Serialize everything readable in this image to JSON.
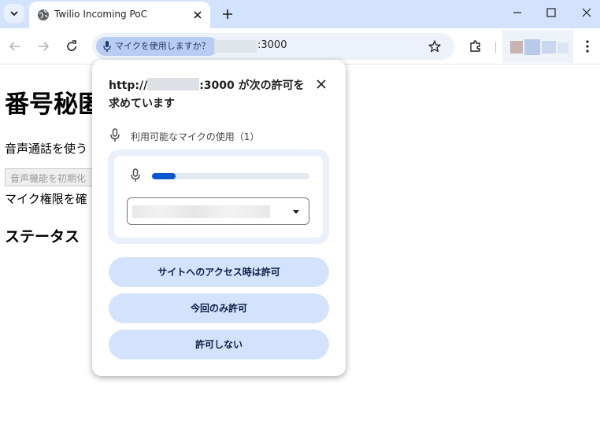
{
  "browser": {
    "tab": {
      "title": "Twilio Incoming PoC",
      "favicon": "globe-icon"
    },
    "omnibox": {
      "permission_chip": "マイクを使用しますか？",
      "url_suffix": ":3000"
    }
  },
  "page": {
    "heading": "番号秘匿",
    "description": "音声通話を使う",
    "init_button": "音声機能を初期化",
    "mic_permission_text": "マイク権限を確",
    "status_heading": "ステータス"
  },
  "permission_prompt": {
    "title_prefix": "http://",
    "title_suffix": ":3000 が次の許可を求めています",
    "permission_item": "利用可能なマイクの使用（1）",
    "mic_level": 0.15,
    "buttons": {
      "allow_on_visit": "サイトへのアクセス時は許可",
      "allow_this_time": "今回のみ許可",
      "deny": "許可しない"
    }
  },
  "colors": {
    "accent": "#0b57d0",
    "chrome_frame": "#d3e3fd",
    "button_bg": "#d3e3fd"
  }
}
